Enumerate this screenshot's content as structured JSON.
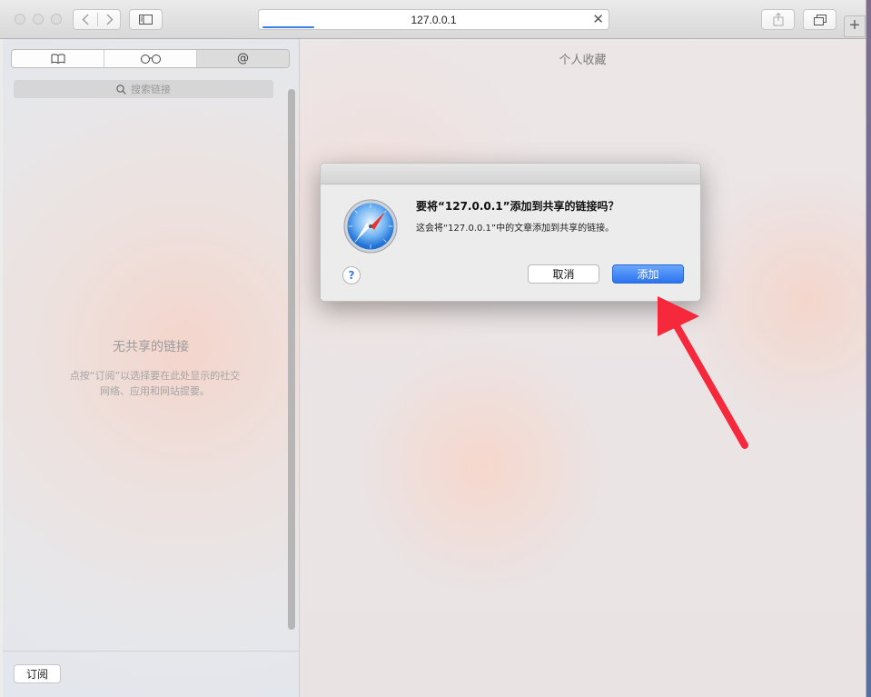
{
  "window": {
    "url": "127.0.0.1",
    "new_tab_label": "+"
  },
  "toolbar": {
    "back_icon": "chevron-left-icon",
    "forward_icon": "chevron-right-icon",
    "sidebar_icon": "sidebar-icon",
    "share_icon": "share-icon",
    "tabs_icon": "tabs-overview-icon",
    "clear_icon": "close-icon",
    "clear_label": "✕",
    "progress_color": "#3b82e0"
  },
  "sidebar": {
    "tabs": [
      {
        "icon": "book-icon",
        "label": ""
      },
      {
        "icon": "glasses-icon",
        "label": ""
      },
      {
        "icon": "at-icon",
        "label": "@"
      }
    ],
    "search_placeholder": "搜索链接",
    "empty_title": "无共享的链接",
    "empty_desc_line1": "点按“订阅”以选择要在此处显示的社交",
    "empty_desc_line2": "网络、应用和网站提要。",
    "subscribe_label": "订阅"
  },
  "main": {
    "title": "个人收藏"
  },
  "dialog": {
    "heading": "要将“127.0.0.1”添加到共享的链接吗？",
    "message": "这会将“127.0.0.1”中的文章添加到共享的链接。",
    "help_label": "?",
    "cancel_label": "取消",
    "add_label": "添加",
    "app_icon": "safari-compass-icon",
    "accent_color": "#2b74f1"
  },
  "annotation": {
    "arrow_color": "#f5293b",
    "arrow_icon": "red-arrow-annotation"
  }
}
